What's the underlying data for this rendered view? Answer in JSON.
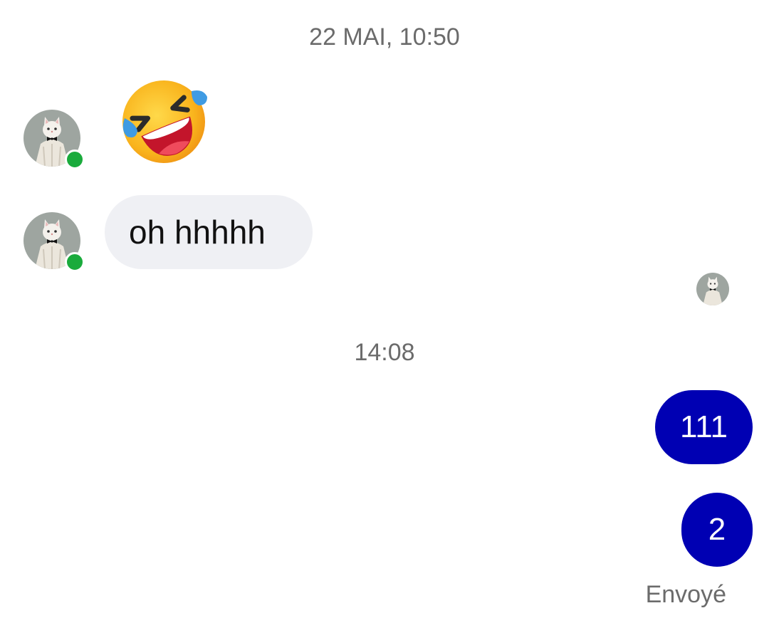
{
  "conversation": {
    "date_separator": "22 MAI, 10:50",
    "time_separator": "14:08",
    "incoming": {
      "emoji_message": "rolling-on-floor-laughing-emoji",
      "text_message": "oh hhhhh",
      "contact_online": true
    },
    "outgoing": {
      "messages": [
        "111",
        "2"
      ],
      "status": "Envoyé"
    }
  },
  "icons": {
    "avatar": "cat-avatar",
    "presence": "online-dot-icon",
    "seen": "seen-avatar"
  },
  "colors": {
    "outgoing_bubble": "#0000b3",
    "incoming_bubble": "#eff0f4",
    "online": "#1aab3c",
    "muted_text": "#6b6b6b"
  }
}
